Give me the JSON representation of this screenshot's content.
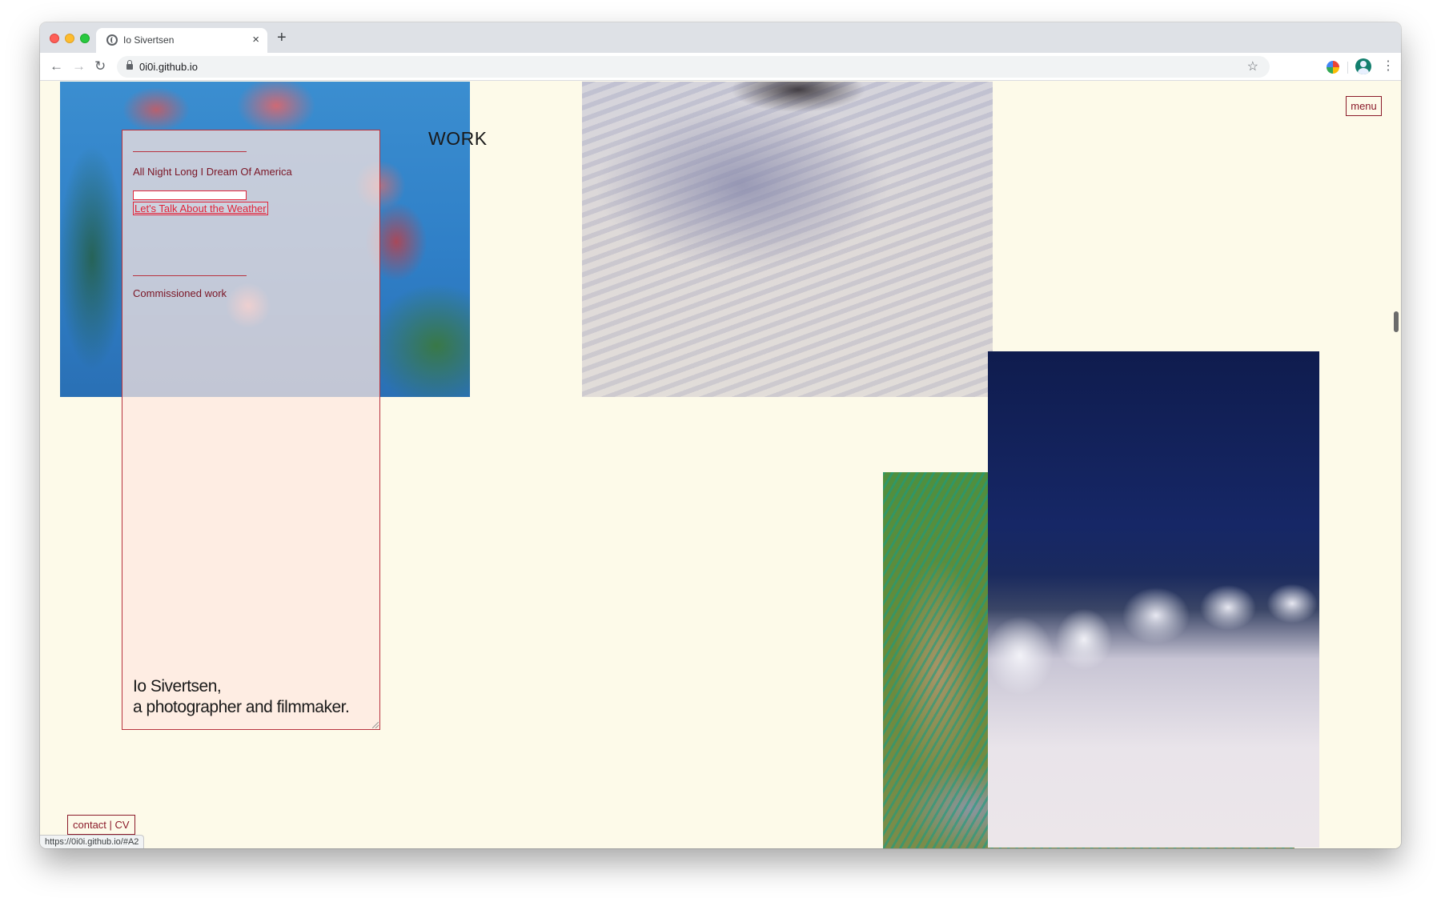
{
  "browser": {
    "tab_title": "Io Sivertsen",
    "tab_close": "×",
    "new_tab": "+",
    "url": "0i0i.github.io",
    "nav_back": "←",
    "nav_forward": "→",
    "nav_reload": "↻",
    "star": "☆",
    "kebab": "⋮",
    "status_url": "https://0i0i.github.io/#A2"
  },
  "page": {
    "heading": "WORK",
    "menu_label": "menu",
    "sidebar": {
      "links": [
        {
          "label": "All Night Long I Dream Of America"
        },
        {
          "label": "Let's Talk About the Weather"
        },
        {
          "label": "Commissioned work"
        }
      ],
      "bio_line1": "Io Sivertsen,",
      "bio_line2": "a photographer and filmmaker."
    },
    "footer": {
      "contact_label": "contact | CV"
    }
  },
  "icons": {
    "favicon": "globe-icon",
    "lock": "lock-icon",
    "star": "star-icon",
    "extension": "chrome-extension-icon",
    "profile": "avatar-icon"
  },
  "colors": {
    "page_background": "#fdfae9",
    "accent_dark_red": "#8b1a2a",
    "accent_red": "#e0243a"
  }
}
